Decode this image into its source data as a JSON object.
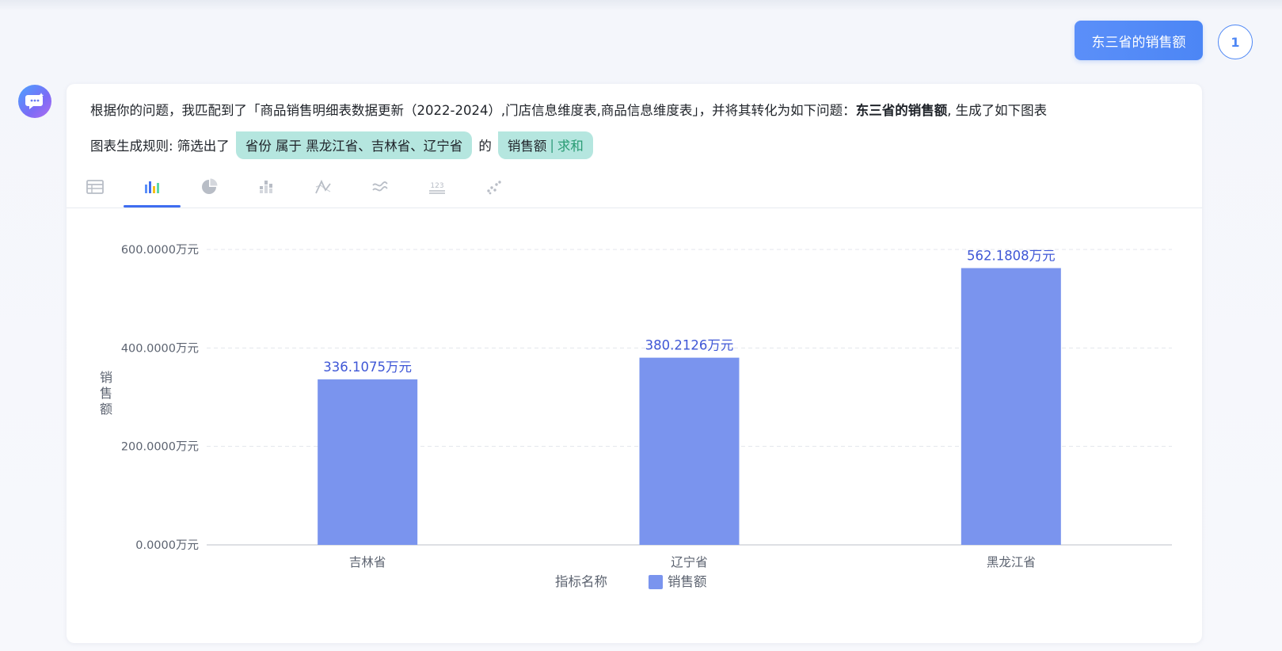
{
  "user_message": {
    "text": "东三省的销售额",
    "avatar_label": "1"
  },
  "answer": {
    "desc_prefix": "根据你的问题，我匹配到了「商品销售明细表数据更新（2022-2024）,门店信息维度表,商品信息维度表」，并将其转化为如下问题：",
    "desc_question": "东三省的销售额",
    "desc_suffix": ", 生成了如下图表",
    "rule_label": "图表生成规则: 筛选出了",
    "filter_chip": "省份 属于 黑龙江省、吉林省、辽宁省",
    "connector": "的",
    "measure_chip": {
      "field": "销售额",
      "separator": "|",
      "aggregation": "求和"
    }
  },
  "chart_tabs": [
    {
      "icon": "table-icon",
      "active": false
    },
    {
      "icon": "bar-chart-icon",
      "active": true
    },
    {
      "icon": "pie-chart-icon",
      "active": false
    },
    {
      "icon": "stacked-bar-icon",
      "active": false
    },
    {
      "icon": "line-chart-icon",
      "active": false
    },
    {
      "icon": "area-chart-icon",
      "active": false
    },
    {
      "icon": "number-card-icon",
      "active": false
    },
    {
      "icon": "scatter-chart-icon",
      "active": false
    }
  ],
  "colors": {
    "accent": "#4c86f5",
    "bar": "#7a94ee",
    "chip": "#b5e6df",
    "label": "#3f57d6"
  },
  "chart_data": {
    "type": "bar",
    "categories": [
      "吉林省",
      "辽宁省",
      "黑龙江省"
    ],
    "series": [
      {
        "name": "销售额",
        "values": [
          336.1075,
          380.2126,
          562.1808
        ],
        "labels": [
          "336.1075万元",
          "380.2126万元",
          "562.1808万元"
        ]
      }
    ],
    "ylabel": "销售额",
    "ylim": [
      0,
      600
    ],
    "yticks": [
      0,
      200,
      400,
      600
    ],
    "ytick_labels": [
      "0.0000万元",
      "200.0000万元",
      "400.0000万元",
      "600.0000万元"
    ],
    "legend_title": "指标名称",
    "legend_position": "bottom-center",
    "grid": true
  }
}
